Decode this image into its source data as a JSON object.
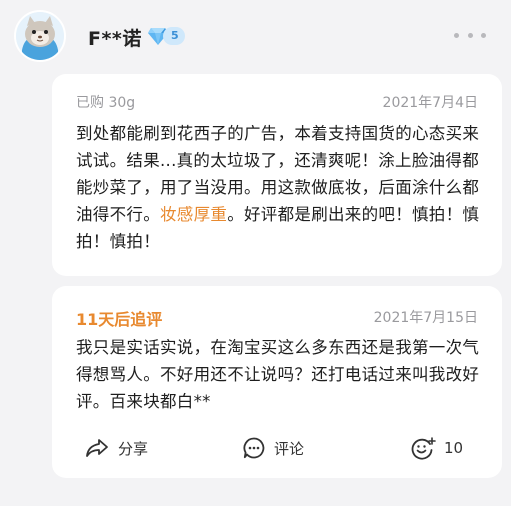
{
  "user": {
    "name": "F**诺",
    "vip_level": "5"
  },
  "review": {
    "purchase_info": "已购 30g",
    "date": "2021年7月4日",
    "text_before": "到处都能刷到花西子的广告，本着支持国货的心态买来试试。结果...真的太垃圾了，还清爽呢！涂上脸油得都能炒菜了，用了当没用。用这款做底妆，后面涂什么都油得不行。",
    "text_highlight": "妆感厚重",
    "text_after": "。好评都是刷出来的吧！慎拍！慎拍！慎拍！"
  },
  "followup": {
    "title": "11天后追评",
    "date": "2021年7月15日",
    "text": "我只是实话实说，在淘宝买这么多东西还是我第一次气得想骂人。不好用还不让说吗？还打电话过来叫我改好评。百来块都白**"
  },
  "actions": {
    "share_label": "分享",
    "comment_label": "评论",
    "like_count": "10"
  },
  "colors": {
    "highlight": "#e8892f",
    "muted": "#9a9a9e",
    "vip_badge": "#cfe8fb"
  },
  "icons": [
    "avatar-cat-icon",
    "diamond-icon",
    "more-dots-icon",
    "share-icon",
    "comment-icon",
    "like-icon"
  ]
}
